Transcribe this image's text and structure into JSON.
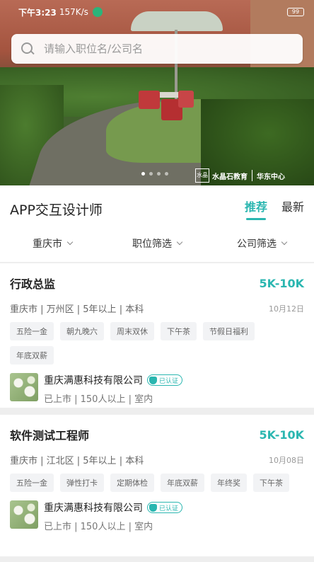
{
  "status_bar": {
    "time": "下午3:23",
    "network_speed": "157K/s",
    "battery": "99"
  },
  "search": {
    "placeholder": "请输入职位名/公司名"
  },
  "banner": {
    "brand_logo": "水晶",
    "brand_name": "水晶石教育",
    "brand_branch": "华东中心",
    "slides": 4,
    "active_slide": 0
  },
  "header": {
    "job_title": "APP交互设计师",
    "tabs": [
      {
        "label": "推荐",
        "active": true
      },
      {
        "label": "最新",
        "active": false
      }
    ]
  },
  "filters": [
    {
      "label": "重庆市"
    },
    {
      "label": "职位筛选"
    },
    {
      "label": "公司筛选"
    }
  ],
  "jobs": [
    {
      "title": "行政总监",
      "salary": "5K-10K",
      "meta": "重庆市 | 万州区 | 5年以上 | 本科",
      "date": "10月12日",
      "tags": [
        "五险一金",
        "朝九晚六",
        "周末双休",
        "下午茶",
        "节假日福利",
        "年底双薪"
      ],
      "company": {
        "name": "重庆满惠科技有限公司",
        "verified_label": "已认证",
        "meta": "已上市 | 150人以上 | 室内"
      }
    },
    {
      "title": "软件测试工程师",
      "salary": "5K-10K",
      "meta": "重庆市 | 江北区 | 5年以上 | 本科",
      "date": "10月08日",
      "tags": [
        "五险一金",
        "弹性打卡",
        "定期体检",
        "年底双薪",
        "年终奖",
        "下午茶"
      ],
      "company": {
        "name": "重庆满惠科技有限公司",
        "verified_label": "已认证",
        "meta": "已上市 | 150人以上 | 室内"
      }
    }
  ],
  "colors": {
    "accent": "#2ab6b0",
    "tag_bg": "#f2f3f5"
  }
}
